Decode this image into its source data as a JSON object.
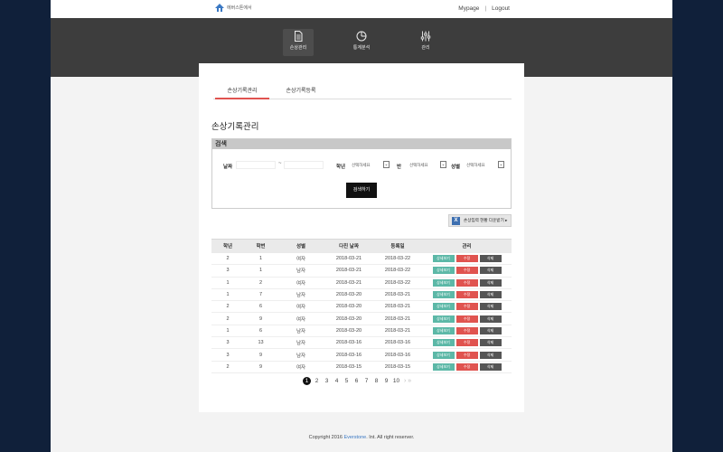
{
  "header": {
    "logo_text": "에버스톤에서",
    "mypage": "Mypage",
    "separator": "|",
    "logout": "Logout"
  },
  "nav": [
    {
      "label": "손상관리",
      "icon": "document-icon",
      "active": true
    },
    {
      "label": "통계분석",
      "icon": "pie-chart-icon",
      "active": false
    },
    {
      "label": "관리",
      "icon": "sliders-icon",
      "active": false
    }
  ],
  "tabs": [
    {
      "label": "손상기록관리",
      "active": true
    },
    {
      "label": "손상기록등록",
      "active": false
    }
  ],
  "page_title": "손상기록관리",
  "search": {
    "heading": "검색",
    "date_label": "날짜",
    "date_separator": "~",
    "grade_label": "학년",
    "grade_value": "선택하세요",
    "class_label": "반",
    "class_value": "선택하세요",
    "gender_label": "성별",
    "gender_value": "선택하세요",
    "submit_label": "검색하기"
  },
  "download_label": "손상임력 현황 다운받기 ▸",
  "table": {
    "headers": [
      "학년",
      "학번",
      "성별",
      "다친 날짜",
      "등록일",
      "관리"
    ],
    "actions": {
      "detail": "상세보기",
      "edit": "수정",
      "delete": "삭제"
    },
    "rows": [
      [
        "2",
        "1",
        "여자",
        "2018-03-21",
        "2018-03-22"
      ],
      [
        "3",
        "1",
        "남자",
        "2018-03-21",
        "2018-03-22"
      ],
      [
        "1",
        "2",
        "여자",
        "2018-03-21",
        "2018-03-22"
      ],
      [
        "1",
        "7",
        "남자",
        "2018-03-20",
        "2018-03-21"
      ],
      [
        "2",
        "6",
        "여자",
        "2018-03-20",
        "2018-03-21"
      ],
      [
        "2",
        "9",
        "여자",
        "2018-03-20",
        "2018-03-21"
      ],
      [
        "1",
        "6",
        "남자",
        "2018-03-20",
        "2018-03-21"
      ],
      [
        "3",
        "13",
        "남자",
        "2018-03-16",
        "2018-03-16"
      ],
      [
        "3",
        "9",
        "남자",
        "2018-03-16",
        "2018-03-16"
      ],
      [
        "2",
        "9",
        "여자",
        "2018-03-15",
        "2018-03-15"
      ]
    ]
  },
  "pagination": {
    "pages": [
      "1",
      "2",
      "3",
      "4",
      "5",
      "6",
      "7",
      "8",
      "9",
      "10"
    ],
    "current": "1",
    "next": "› »"
  },
  "footer": {
    "prefix": "Copyright 2016 ",
    "brand": "Everstone",
    "suffix": ". Int. All right reserver."
  },
  "colors": {
    "accent_red": "#e0534f",
    "detail_teal": "#5cb8a7",
    "nav_band": "#3d3d3d",
    "brand_blue": "#3a78c3"
  }
}
